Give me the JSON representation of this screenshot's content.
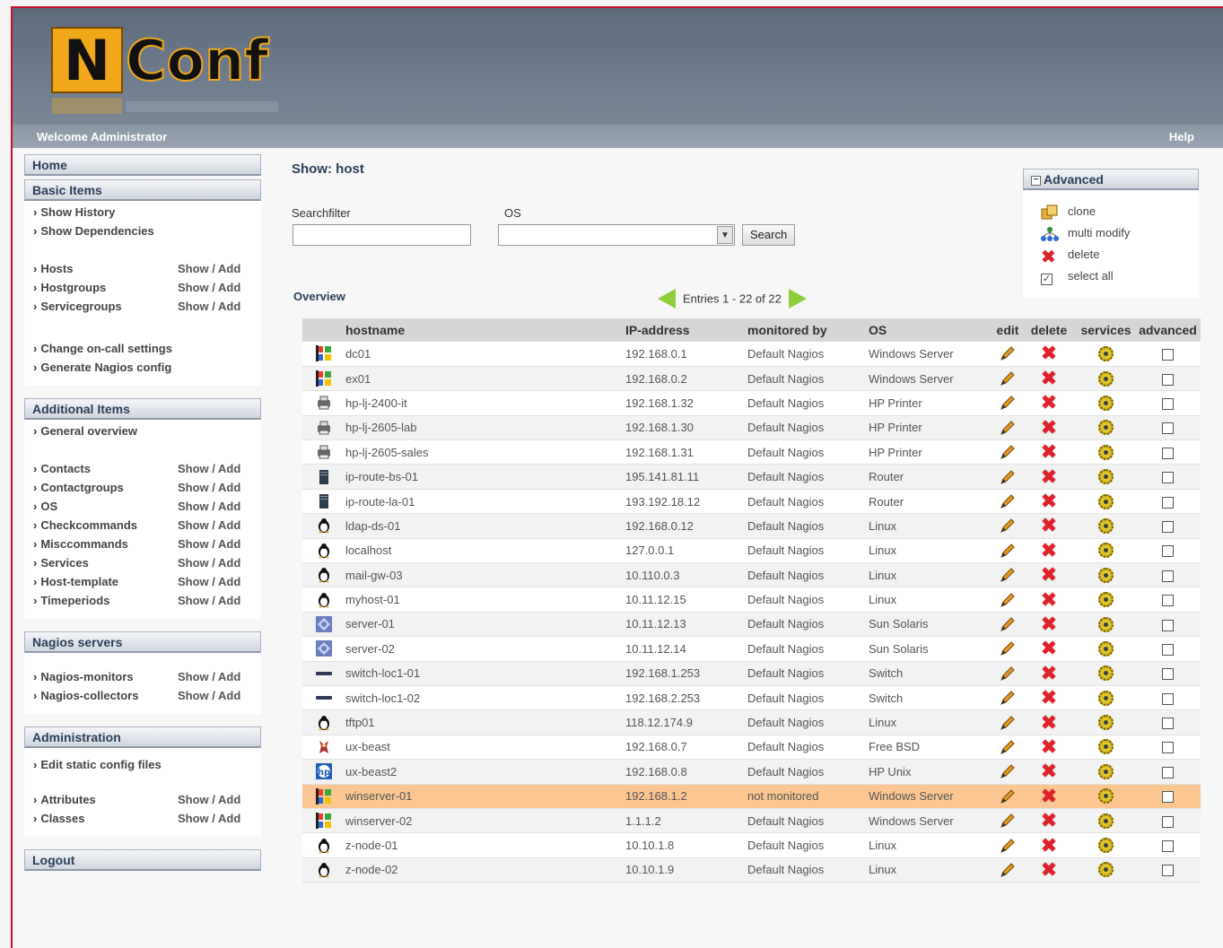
{
  "header": {
    "logo_text": "NConf",
    "welcome": "Welcome Administrator",
    "help": "Help"
  },
  "sidebar": {
    "home": "Home",
    "basic": {
      "title": "Basic Items",
      "links1": [
        "Show History",
        "Show Dependencies"
      ],
      "items": [
        {
          "label": "Hosts",
          "action": "Show / Add"
        },
        {
          "label": "Hostgroups",
          "action": "Show / Add"
        },
        {
          "label": "Servicegroups",
          "action": "Show / Add"
        }
      ],
      "links2": [
        "Change on-call settings",
        "Generate Nagios config"
      ]
    },
    "additional": {
      "title": "Additional Items",
      "links1": [
        "General overview"
      ],
      "items": [
        {
          "label": "Contacts",
          "action": "Show / Add"
        },
        {
          "label": "Contactgroups",
          "action": "Show / Add"
        },
        {
          "label": "OS",
          "action": "Show / Add"
        },
        {
          "label": "Checkcommands",
          "action": "Show / Add"
        },
        {
          "label": "Misccommands",
          "action": "Show / Add"
        },
        {
          "label": "Services",
          "action": "Show / Add"
        },
        {
          "label": "Host-template",
          "action": "Show / Add"
        },
        {
          "label": "Timeperiods",
          "action": "Show / Add"
        }
      ]
    },
    "nagios": {
      "title": "Nagios servers",
      "items": [
        {
          "label": "Nagios-monitors",
          "action": "Show / Add"
        },
        {
          "label": "Nagios-collectors",
          "action": "Show / Add"
        }
      ]
    },
    "admin": {
      "title": "Administration",
      "links1": [
        "Edit static config files"
      ],
      "items": [
        {
          "label": "Attributes",
          "action": "Show / Add"
        },
        {
          "label": "Classes",
          "action": "Show / Add"
        }
      ]
    },
    "logout": "Logout"
  },
  "main": {
    "title": "Show: host",
    "searchfilter_label": "Searchfilter",
    "searchfilter_value": "",
    "os_label": "OS",
    "os_value": "",
    "search_button": "Search",
    "overview": "Overview",
    "entries": "Entries 1 - 22 of 22",
    "columns": [
      "hostname",
      "IP-address",
      "monitored by",
      "OS",
      "edit",
      "delete",
      "services",
      "advanced"
    ],
    "rows": [
      {
        "icon": "windows-icon",
        "hostname": "dc01",
        "ip": "192.168.0.1",
        "monitored": "Default Nagios",
        "os": "Windows Server"
      },
      {
        "icon": "windows-icon",
        "hostname": "ex01",
        "ip": "192.168.0.2",
        "monitored": "Default Nagios",
        "os": "Windows Server"
      },
      {
        "icon": "printer-icon",
        "hostname": "hp-lj-2400-it",
        "ip": "192.168.1.32",
        "monitored": "Default Nagios",
        "os": "HP Printer"
      },
      {
        "icon": "printer-icon",
        "hostname": "hp-lj-2605-lab",
        "ip": "192.168.1.30",
        "monitored": "Default Nagios",
        "os": "HP Printer"
      },
      {
        "icon": "printer-icon",
        "hostname": "hp-lj-2605-sales",
        "ip": "192.168.1.31",
        "monitored": "Default Nagios",
        "os": "HP Printer"
      },
      {
        "icon": "router-icon",
        "hostname": "ip-route-bs-01",
        "ip": "195.141.81.11",
        "monitored": "Default Nagios",
        "os": "Router"
      },
      {
        "icon": "router-icon",
        "hostname": "ip-route-la-01",
        "ip": "193.192.18.12",
        "monitored": "Default Nagios",
        "os": "Router"
      },
      {
        "icon": "linux-icon",
        "hostname": "ldap-ds-01",
        "ip": "192.168.0.12",
        "monitored": "Default Nagios",
        "os": "Linux"
      },
      {
        "icon": "linux-icon",
        "hostname": "localhost",
        "ip": "127.0.0.1",
        "monitored": "Default Nagios",
        "os": "Linux"
      },
      {
        "icon": "linux-icon",
        "hostname": "mail-gw-03",
        "ip": "10.110.0.3",
        "monitored": "Default Nagios",
        "os": "Linux"
      },
      {
        "icon": "linux-icon",
        "hostname": "myhost-01",
        "ip": "10.11.12.15",
        "monitored": "Default Nagios",
        "os": "Linux"
      },
      {
        "icon": "solaris-icon",
        "hostname": "server-01",
        "ip": "10.11.12.13",
        "monitored": "Default Nagios",
        "os": "Sun Solaris"
      },
      {
        "icon": "solaris-icon",
        "hostname": "server-02",
        "ip": "10.11.12.14",
        "monitored": "Default Nagios",
        "os": "Sun Solaris"
      },
      {
        "icon": "switch-icon",
        "hostname": "switch-loc1-01",
        "ip": "192.168.1.253",
        "monitored": "Default Nagios",
        "os": "Switch"
      },
      {
        "icon": "switch-icon",
        "hostname": "switch-loc1-02",
        "ip": "192.168.2.253",
        "monitored": "Default Nagios",
        "os": "Switch"
      },
      {
        "icon": "linux-icon",
        "hostname": "tftp01",
        "ip": "118.12.174.9",
        "monitored": "Default Nagios",
        "os": "Linux"
      },
      {
        "icon": "freebsd-icon",
        "hostname": "ux-beast",
        "ip": "192.168.0.7",
        "monitored": "Default Nagios",
        "os": "Free BSD"
      },
      {
        "icon": "hp-unix-icon",
        "hostname": "ux-beast2",
        "ip": "192.168.0.8",
        "monitored": "Default Nagios",
        "os": "HP Unix"
      },
      {
        "icon": "windows-icon",
        "hostname": "winserver-01",
        "ip": "192.168.1.2",
        "monitored": "not monitored",
        "os": "Windows Server",
        "highlight": true
      },
      {
        "icon": "windows-icon",
        "hostname": "winserver-02",
        "ip": "1.1.1.2",
        "monitored": "Default Nagios",
        "os": "Windows Server"
      },
      {
        "icon": "linux-icon",
        "hostname": "z-node-01",
        "ip": "10.10.1.8",
        "monitored": "Default Nagios",
        "os": "Linux"
      },
      {
        "icon": "linux-icon",
        "hostname": "z-node-02",
        "ip": "10.10.1.9",
        "monitored": "Default Nagios",
        "os": "Linux"
      }
    ]
  },
  "advanced": {
    "title": "Advanced",
    "items": [
      {
        "icon": "clone-icon",
        "label": "clone"
      },
      {
        "icon": "multi-modify-icon",
        "label": "multi modify"
      },
      {
        "icon": "delete-icon",
        "label": "delete"
      },
      {
        "icon": "select-all-checkbox",
        "label": "select all"
      }
    ]
  },
  "colors": {
    "highlight_row": "#fbc692",
    "not_monitored": "#e01010",
    "pager_arrow": "#8fce3c",
    "header_bg": "#6e7c8e"
  }
}
